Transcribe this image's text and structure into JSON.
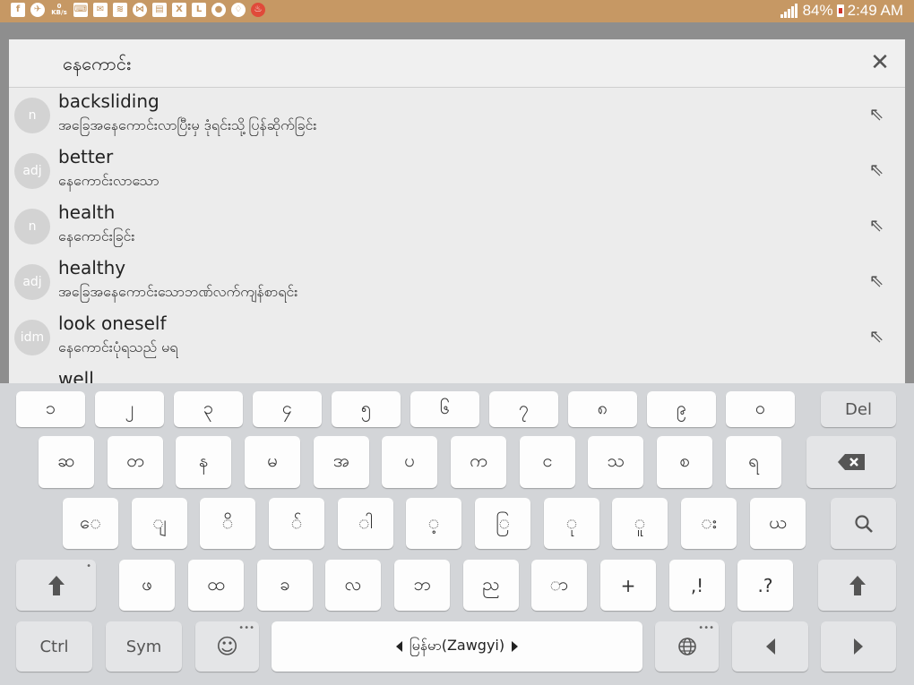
{
  "status_bar": {
    "left_icons": [
      "facebook-icon",
      "notification-icon",
      "data-speed-icon",
      "keyboard-icon",
      "chat-icon",
      "wifi-icon",
      "share-icon",
      "news-icon",
      "x-icon",
      "line-icon",
      "line-chat-icon",
      "bulb-icon",
      "fire-icon"
    ],
    "data_speed_value": "0",
    "data_speed_unit": "KB/s",
    "battery": "84%",
    "time": "2:49 AM",
    "bar_color": "#c69864"
  },
  "search": {
    "value": "နေကောင်း",
    "close_label": "✕"
  },
  "results": [
    {
      "pos": "n",
      "word": "backsliding",
      "meaning": "အခြေအနေကောင်းလာပြီးမှ ဒုံရင်းသို့ပြန်ဆိုက်ခြင်း"
    },
    {
      "pos": "adj",
      "word": "better",
      "meaning": "နေကောင်းလာသော"
    },
    {
      "pos": "n",
      "word": "health",
      "meaning": "နေကောင်းခြင်း"
    },
    {
      "pos": "adj",
      "word": "healthy",
      "meaning": "အခြေအနေကောင်းသောဘဏ်လက်ကျန်စာရင်း"
    },
    {
      "pos": "idm",
      "word": "look oneself",
      "meaning": "နေကောင်းပုံရသည် မရ"
    },
    {
      "pos": "",
      "word": "well",
      "meaning": ""
    }
  ],
  "keyboard": {
    "row1": [
      "၁",
      "၂",
      "၃",
      "၄",
      "၅",
      "၆",
      "၇",
      "၈",
      "၉",
      "၀"
    ],
    "row1_del": "Del",
    "row2": [
      "ဆ",
      "တ",
      "န",
      "မ",
      "အ",
      "ပ",
      "က",
      "င",
      "သ",
      "စ",
      "ရ"
    ],
    "row3": [
      "ေ",
      "ျ",
      "ိ",
      "်",
      "ါ",
      "့",
      "ြ",
      "ု",
      "ူ",
      "း",
      "ယ"
    ],
    "row4": [
      "ဖ",
      "ထ",
      "ခ",
      "လ",
      "ဘ",
      "ည",
      "ာ",
      "+",
      ",!",
      ".?"
    ],
    "ctrl": "Ctrl",
    "sym": "Sym",
    "space_label": "မြန်မာ(Zawgyi)",
    "emoji_icon": "☺",
    "globe_icon": "🌐"
  }
}
